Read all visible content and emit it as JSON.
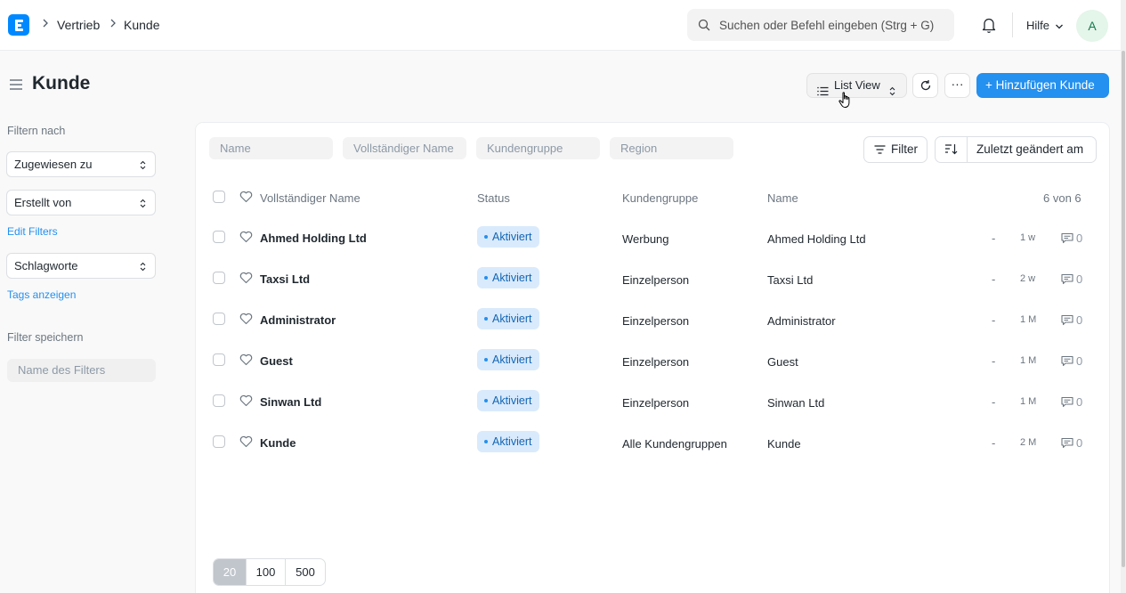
{
  "navbar": {
    "breadcrumbs": [
      "Vertrieb",
      "Kunde"
    ],
    "search_placeholder": "Suchen oder Befehl eingeben (Strg + G)",
    "help_label": "Hilfe",
    "avatar_initial": "A"
  },
  "page": {
    "title": "Kunde",
    "list_view_label": "List View",
    "more_label": "···",
    "add_button_label": "+ Hinzufügen Kunde"
  },
  "sidebar": {
    "filter_heading": "Filtern nach",
    "assigned_to": "Zugewiesen zu",
    "created_by": "Erstellt von",
    "edit_filters": "Edit Filters",
    "tags": "Schlagworte",
    "show_tags": "Tags anzeigen",
    "save_filter_heading": "Filter speichern",
    "filter_name_placeholder": "Name des Filters"
  },
  "filters": {
    "name_placeholder": "Name",
    "full_name_placeholder": "Vollständiger Name",
    "group_placeholder": "Kundengruppe",
    "region_placeholder": "Region",
    "filter_label": "Filter",
    "sort_label": "Zuletzt geändert am"
  },
  "table": {
    "headers": {
      "full_name": "Vollständiger Name",
      "status": "Status",
      "group": "Kundengruppe",
      "name": "Name"
    },
    "count": "6 von 6",
    "rows": [
      {
        "full_name": "Ahmed Holding Ltd",
        "status": "Aktiviert",
        "group": "Werbung",
        "name": "Ahmed Holding Ltd",
        "dash": "-",
        "time": "1 w",
        "comments": "0"
      },
      {
        "full_name": "Taxsi Ltd",
        "status": "Aktiviert",
        "group": "Einzelperson",
        "name": "Taxsi Ltd",
        "dash": "-",
        "time": "2 w",
        "comments": "0"
      },
      {
        "full_name": "Administrator",
        "status": "Aktiviert",
        "group": "Einzelperson",
        "name": "Administrator",
        "dash": "-",
        "time": "1 M",
        "comments": "0"
      },
      {
        "full_name": "Guest",
        "status": "Aktiviert",
        "group": "Einzelperson",
        "name": "Guest",
        "dash": "-",
        "time": "1 M",
        "comments": "0"
      },
      {
        "full_name": "Sinwan Ltd",
        "status": "Aktiviert",
        "group": "Einzelperson",
        "name": "Sinwan Ltd",
        "dash": "-",
        "time": "1 M",
        "comments": "0"
      },
      {
        "full_name": "Kunde",
        "status": "Aktiviert",
        "group": "Alle Kundengruppen",
        "name": "Kunde",
        "dash": "-",
        "time": "2 M",
        "comments": "0"
      }
    ]
  },
  "paging": [
    "20",
    "100",
    "500"
  ],
  "colors": {
    "accent": "#2490ef",
    "badge_bg": "#d9eafc",
    "badge_text": "#1366b3"
  }
}
